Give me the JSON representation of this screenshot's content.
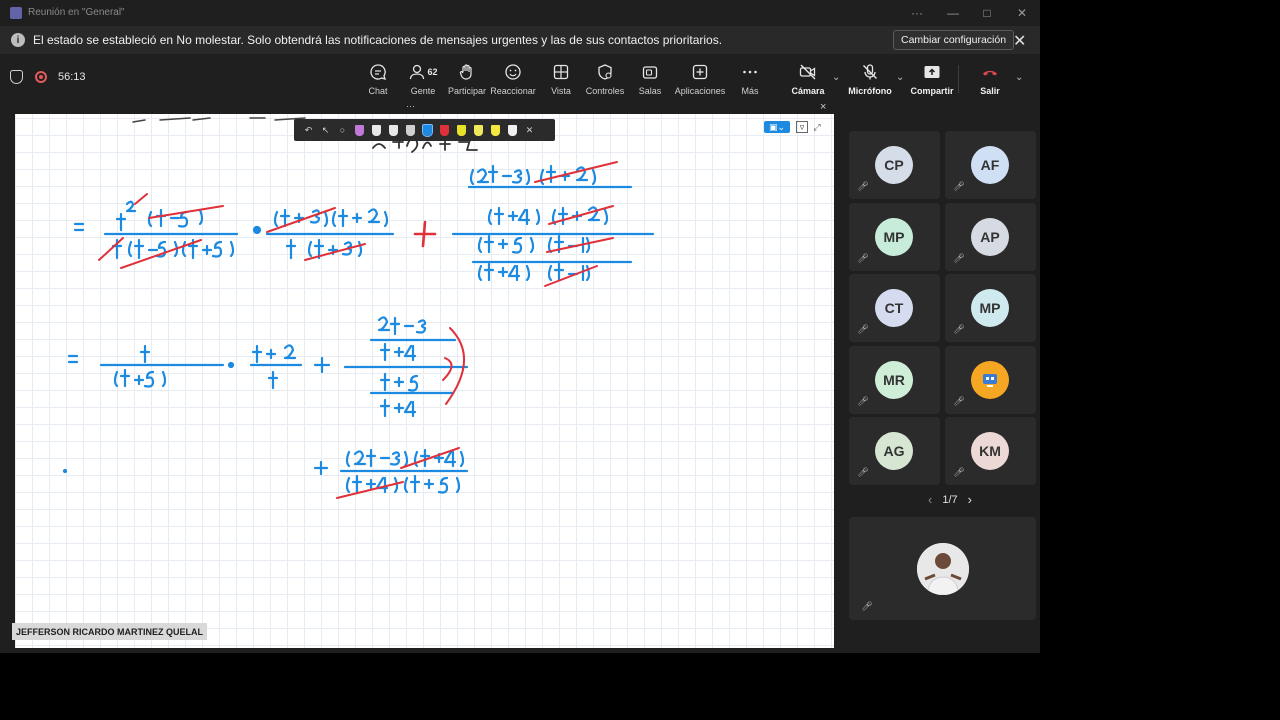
{
  "window": {
    "title": "Reunión en \"General\"",
    "controls": {
      "more": "···",
      "minimize": "—",
      "maximize": "□",
      "close": "✕"
    }
  },
  "banner": {
    "info_icon": "i",
    "message": "El estado se estableció en No molestar. Solo obtendrá las notificaciones de mensajes urgentes y las de sus contactos prioritarios.",
    "settings_button": "Cambiar configuración",
    "close": "✕"
  },
  "toolbar": {
    "timer": "56:13",
    "people_count": "62",
    "buttons": [
      {
        "label": "Chat",
        "icon": "chat-icon"
      },
      {
        "label": "Gente",
        "icon": "people-icon"
      },
      {
        "label": "Participar",
        "icon": "raise-hand-icon"
      },
      {
        "label": "Reaccionar",
        "icon": "smile-icon"
      },
      {
        "label": "Vista",
        "icon": "grid-icon"
      },
      {
        "label": "Controles",
        "icon": "shield-icon"
      },
      {
        "label": "Salas",
        "icon": "rooms-icon"
      },
      {
        "label": "Aplicaciones",
        "icon": "plus-icon"
      },
      {
        "label": "Más",
        "icon": "more-icon"
      },
      {
        "label": "Cámara",
        "icon": "camera-off-icon"
      },
      {
        "label": "Micrófono",
        "icon": "mic-off-icon"
      },
      {
        "label": "Compartir",
        "icon": "share-icon"
      },
      {
        "label": "Salir",
        "icon": "hangup-icon"
      }
    ]
  },
  "stage": {
    "presenter_name": "JEFFERSON RICARDO MARTINEZ QUELAL",
    "close": "×",
    "handle": "···"
  },
  "participants": {
    "tiles": [
      {
        "initials": "CP",
        "color": "#d5dde8"
      },
      {
        "initials": "AF",
        "color": "#cfe0f5"
      },
      {
        "initials": "MP",
        "color": "#c7ecd9"
      },
      {
        "initials": "AP",
        "color": "#d6dbe3"
      },
      {
        "initials": "CT",
        "color": "#d5dcf0"
      },
      {
        "initials": "MP",
        "color": "#cfeaee"
      },
      {
        "initials": "MR",
        "color": "#cfeed8"
      },
      {
        "initials": "",
        "color": "#f5a623"
      },
      {
        "initials": "AG",
        "color": "#d6e6d2"
      },
      {
        "initials": "KM",
        "color": "#ecd9d6"
      }
    ],
    "page": "1/7"
  }
}
